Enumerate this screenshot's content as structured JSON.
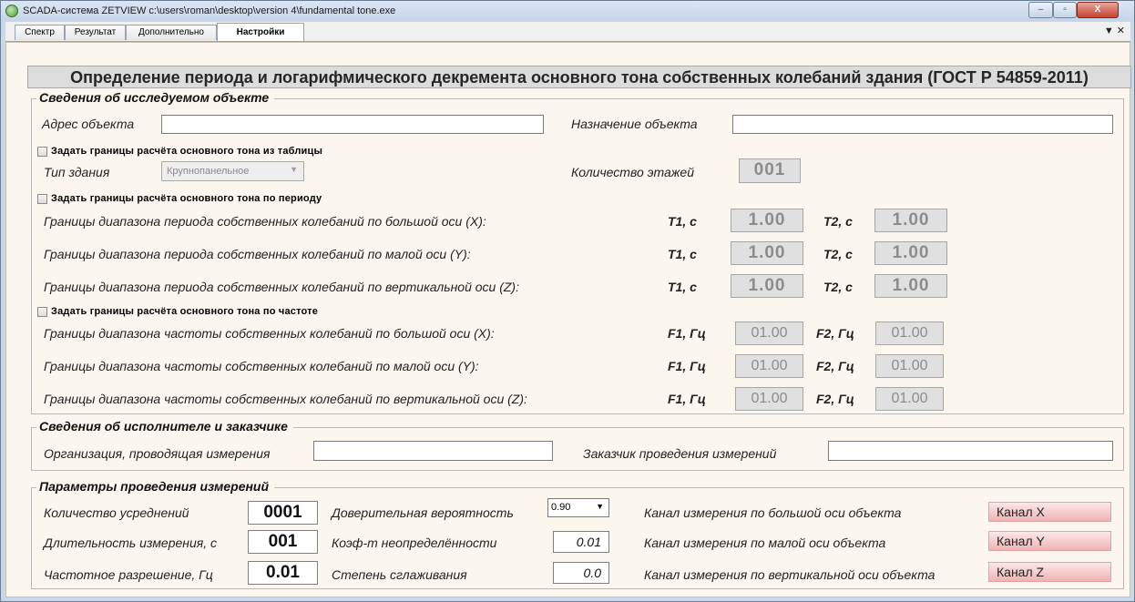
{
  "window": {
    "title": "SCADA-система ZETVIEW c:\\users\\roman\\desktop\\version 4\\fundamental tone.exe",
    "minimize": "–",
    "maximize": "▫",
    "close": "X"
  },
  "tabs": [
    {
      "label": "Спектр"
    },
    {
      "label": "Результат"
    },
    {
      "label": "Дополнительно"
    },
    {
      "label": "Настройки"
    }
  ],
  "tab_menu": "▼ ✕",
  "header": {
    "title": "Определение периода и логарифмического декремента основного тона собственных колебаний здания (ГОСТ Р 54859-2011)"
  },
  "object": {
    "legend": "Сведения об исследуемом объекте",
    "address_label": "Адрес объекта",
    "address_value": "",
    "purpose_label": "Назначение объекта",
    "purpose_value": "",
    "table_check": "Задать границы расчёта основного тона из таблицы",
    "building_type_label": "Тип здания",
    "building_type_value": "Крупнопанельное",
    "floors_label": "Количество этажей",
    "floors_value": "001",
    "period_check": "Задать границы расчёта основного тона по периоду",
    "period_rows": [
      {
        "label": "Границы диапазона периода собственных колебаний по большой оси (X):",
        "t1_label": "T1, с",
        "t1": "1.00",
        "t2_label": "T2, с",
        "t2": "1.00"
      },
      {
        "label": "Границы диапазона периода собственных колебаний по малой оси (Y):",
        "t1_label": "T1, с",
        "t1": "1.00",
        "t2_label": "T2, с",
        "t2": "1.00"
      },
      {
        "label": "Границы диапазона периода собственных колебаний по вертикальной оси (Z):",
        "t1_label": "T1, с",
        "t1": "1.00",
        "t2_label": "T2, с",
        "t2": "1.00"
      }
    ],
    "freq_check": "Задать границы расчёта основного тона по частоте",
    "freq_rows": [
      {
        "label": "Границы диапазона частоты собственных колебаний по большой оси (X):",
        "f1_label": "F1, Гц",
        "f1": "01.00",
        "f2_label": "F2, Гц",
        "f2": "01.00"
      },
      {
        "label": "Границы диапазона частоты собственных колебаний по малой оси (Y):",
        "f1_label": "F1, Гц",
        "f1": "01.00",
        "f2_label": "F2, Гц",
        "f2": "01.00"
      },
      {
        "label": "Границы диапазона частоты собственных колебаний по вертикальной оси (Z):",
        "f1_label": "F1, Гц",
        "f1": "01.00",
        "f2_label": "F2, Гц",
        "f2": "01.00"
      }
    ]
  },
  "executor": {
    "legend": "Сведения об исполнителе и заказчике",
    "org_label": "Организация, проводящая измерения",
    "org_value": "",
    "customer_label": "Заказчик проведения измерений",
    "customer_value": ""
  },
  "params": {
    "legend": "Параметры проведения измерений",
    "averaging_label": "Количество усреднений",
    "averaging_value": "0001",
    "duration_label": "Длительность измерения, с",
    "duration_value": "001",
    "resolution_label": "Частотное разрешение, Гц",
    "resolution_value": "0.01",
    "confidence_label": "Доверительная вероятность",
    "confidence_value": "0.90",
    "uncertainty_label": "Коэф-т неопределённости",
    "uncertainty_value": "0.01",
    "smoothing_label": "Степень сглаживания",
    "smoothing_value": "0.0",
    "channel_x_label": "Канал измерения по большой оси объекта",
    "channel_x_value": "Канал X",
    "channel_y_label": "Канал измерения по малой оси объекта",
    "channel_y_value": "Канал Y",
    "channel_z_label": "Канал измерения по вертикальной оси объекта",
    "channel_z_value": "Канал Z"
  }
}
